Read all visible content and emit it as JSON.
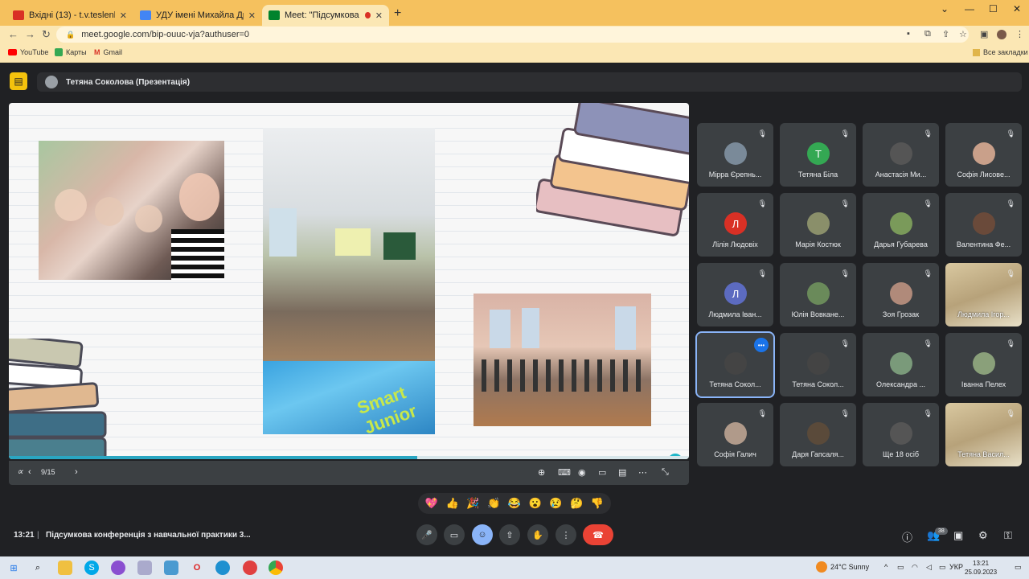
{
  "browser": {
    "tabs": [
      {
        "title": "Вхідні (13) - t.v.teslenko@npu.e",
        "favicon_color": "#d93025"
      },
      {
        "title": "УДУ імені Михайла Драгоманов",
        "favicon_color": "#4285f4"
      },
      {
        "title": "Meet: \"Підсумкова конфере",
        "favicon_color": "#00832d"
      }
    ],
    "url": "meet.google.com/bip-ouuc-vja?authuser=0",
    "bookmarks": [
      {
        "label": "YouTube"
      },
      {
        "label": "Карты"
      },
      {
        "label": "Gmail"
      }
    ],
    "all_bookmarks": "Все закладки"
  },
  "meet": {
    "presenter_label": "Тетяна Соколова (Презентація)",
    "slide": {
      "page_indicator": "9/15",
      "progress": 0.6,
      "photo_label": "Smart Junior"
    },
    "participants": [
      {
        "name": "Мірра Єрепнь...",
        "avatar_color": "#7a8a99",
        "initial": ""
      },
      {
        "name": "Тетяна Біла",
        "avatar_color": "#34a853",
        "initial": "Т"
      },
      {
        "name": "Анастасія Ми...",
        "avatar_color": "#555",
        "initial": ""
      },
      {
        "name": "Софія Лисове...",
        "avatar_color": "#c9a08a",
        "initial": ""
      },
      {
        "name": "Лілія Людовіх",
        "avatar_color": "#d93025",
        "initial": "Л"
      },
      {
        "name": "Марія Костюк",
        "avatar_color": "#8a8f6a",
        "initial": ""
      },
      {
        "name": "Дарья Губарева",
        "avatar_color": "#7a9a5a",
        "initial": ""
      },
      {
        "name": "Валентина Фе...",
        "avatar_color": "#6a4a3a",
        "initial": ""
      },
      {
        "name": "Людмила Іван...",
        "avatar_color": "#5c6bc0",
        "initial": "Л"
      },
      {
        "name": "Юлія Вовкане...",
        "avatar_color": "#6a8a5a",
        "initial": ""
      },
      {
        "name": "Зоя Грозак",
        "avatar_color": "#b08a7a",
        "initial": ""
      },
      {
        "name": "Людмила Ігор...",
        "avatar_color": "",
        "initial": ""
      },
      {
        "name": "Тетяна Сокол...",
        "avatar_color": "#444",
        "initial": ""
      },
      {
        "name": "Тетяна Сокол...",
        "avatar_color": "#444",
        "initial": ""
      },
      {
        "name": "Олександра ...",
        "avatar_color": "#7a9a7a",
        "initial": ""
      },
      {
        "name": "Іванна Пелех",
        "avatar_color": "#8aa07a",
        "initial": ""
      },
      {
        "name": "Софія Галич",
        "avatar_color": "#b09a8a",
        "initial": ""
      },
      {
        "name": "Даря Гапсаля...",
        "avatar_color": "#5a4a3a",
        "initial": ""
      },
      {
        "name": "Ще 18 осіб",
        "avatar_color": "#555",
        "initial": ""
      },
      {
        "name": "Тетяна Васил...",
        "avatar_color": "",
        "initial": ""
      }
    ],
    "reactions": [
      "💖",
      "👍",
      "🎉",
      "👏",
      "😂",
      "😮",
      "😢",
      "🤔",
      "👎"
    ],
    "time": "13:21",
    "separator": "|",
    "meeting_title": "Підсумкова конференція з навчальної практики 3...",
    "participant_count": "38"
  },
  "taskbar": {
    "weather": "24°C  Sunny",
    "lang": "УКР",
    "clock_time": "13:21",
    "clock_date": "25.09.2023"
  }
}
